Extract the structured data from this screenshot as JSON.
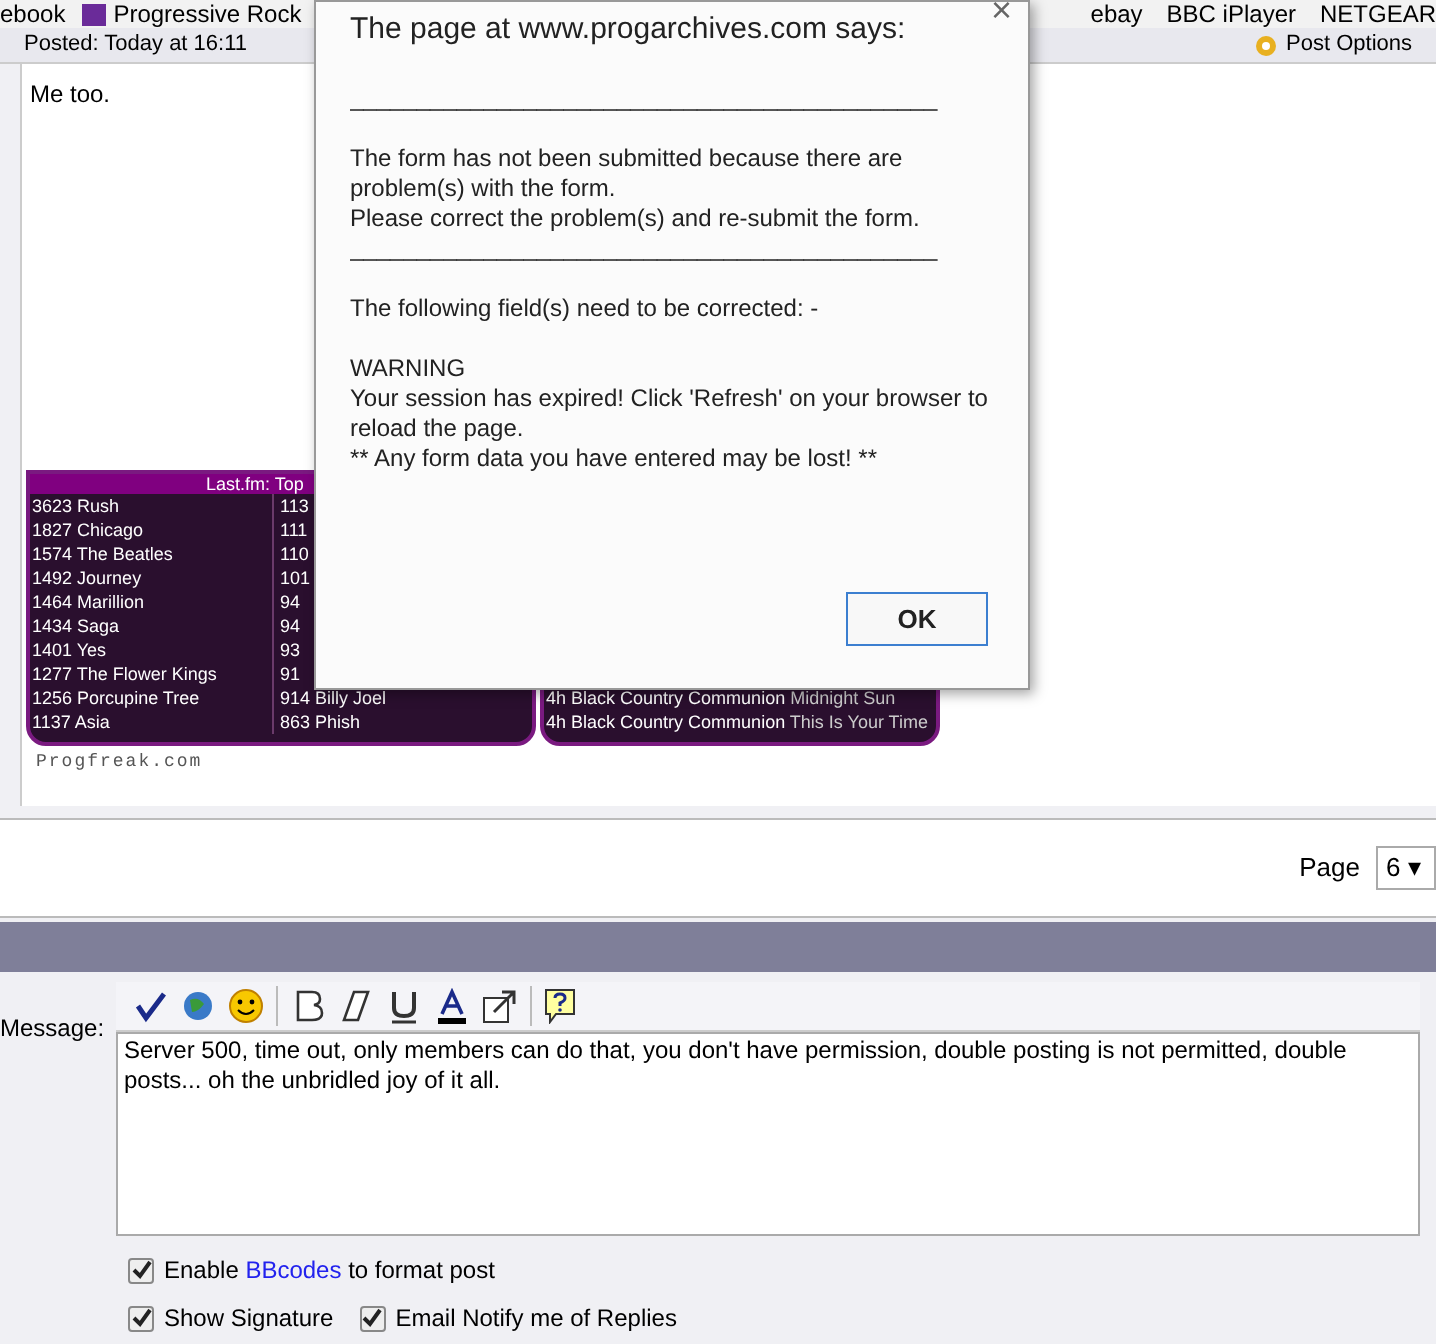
{
  "bookmarks_left": [
    {
      "label": "ebook"
    },
    {
      "label": "Progressive Rock"
    }
  ],
  "bookmarks_right": [
    {
      "label": "ebay"
    },
    {
      "label": "BBC iPlayer"
    },
    {
      "label": "NETGEAR"
    }
  ],
  "post": {
    "posted": "Posted: Today at 16:11",
    "options": "Post Options",
    "body": "Me too."
  },
  "widget": {
    "header": "Last.fm: Top",
    "left_rows": [
      {
        "count": "3623",
        "artist": "Rush"
      },
      {
        "count": "1827",
        "artist": "Chicago"
      },
      {
        "count": "1574",
        "artist": "The Beatles"
      },
      {
        "count": "1492",
        "artist": "Journey"
      },
      {
        "count": "1464",
        "artist": "Marillion"
      },
      {
        "count": "1434",
        "artist": "Saga"
      },
      {
        "count": "1401",
        "artist": "Yes"
      },
      {
        "count": "1277",
        "artist": "The Flower Kings"
      },
      {
        "count": "1256",
        "artist": "Porcupine Tree"
      },
      {
        "count": "1137",
        "artist": "Asia"
      }
    ],
    "middle_rows": [
      {
        "count": "113"
      },
      {
        "count": "111"
      },
      {
        "count": "110"
      },
      {
        "count": "101"
      },
      {
        "count": "94"
      },
      {
        "count": "94"
      },
      {
        "count": "93"
      },
      {
        "count": "91"
      },
      {
        "count": "914",
        "artist": "Billy Joel"
      },
      {
        "count": "863",
        "artist": "Phish"
      }
    ],
    "recent": [
      {
        "time": "4h",
        "artist": "Black Country Communion",
        "track": "Midnight Sun"
      },
      {
        "time": "4h",
        "artist": "Black Country Communion",
        "track": "This Is Your Time"
      }
    ],
    "footer": "Progfreak.com"
  },
  "pager": {
    "label": "Page",
    "value": "6",
    "arrow": "▾"
  },
  "form": {
    "label": "Message:",
    "text": "Server 500, time out, only members can do that, you don't have permission, double posting is not permitted, double posts... oh the unbridled joy of it all.",
    "options": [
      {
        "before": "Enable ",
        "link": "BBcodes",
        "after": " to format post",
        "checked": true
      },
      {
        "before": "Show Signature",
        "checked": true
      },
      {
        "before": "Email Notify me of Replies",
        "checked": true
      }
    ]
  },
  "dialog": {
    "title": "The page at www.progarchives.com says:",
    "close": "×",
    "rule": "____________________________________________",
    "lines": [
      "The form has not been submitted because there are problem(s) with the form.",
      "Please correct the problem(s) and re-submit the form."
    ],
    "rule2": "____________________________________________",
    "fields": "The following field(s) need to be corrected: -",
    "warning": "WARNING",
    "message": "Your session has expired! Click 'Refresh' on your browser to reload the page.",
    "note": "** Any form data you have entered may be lost! **",
    "ok": "OK"
  }
}
